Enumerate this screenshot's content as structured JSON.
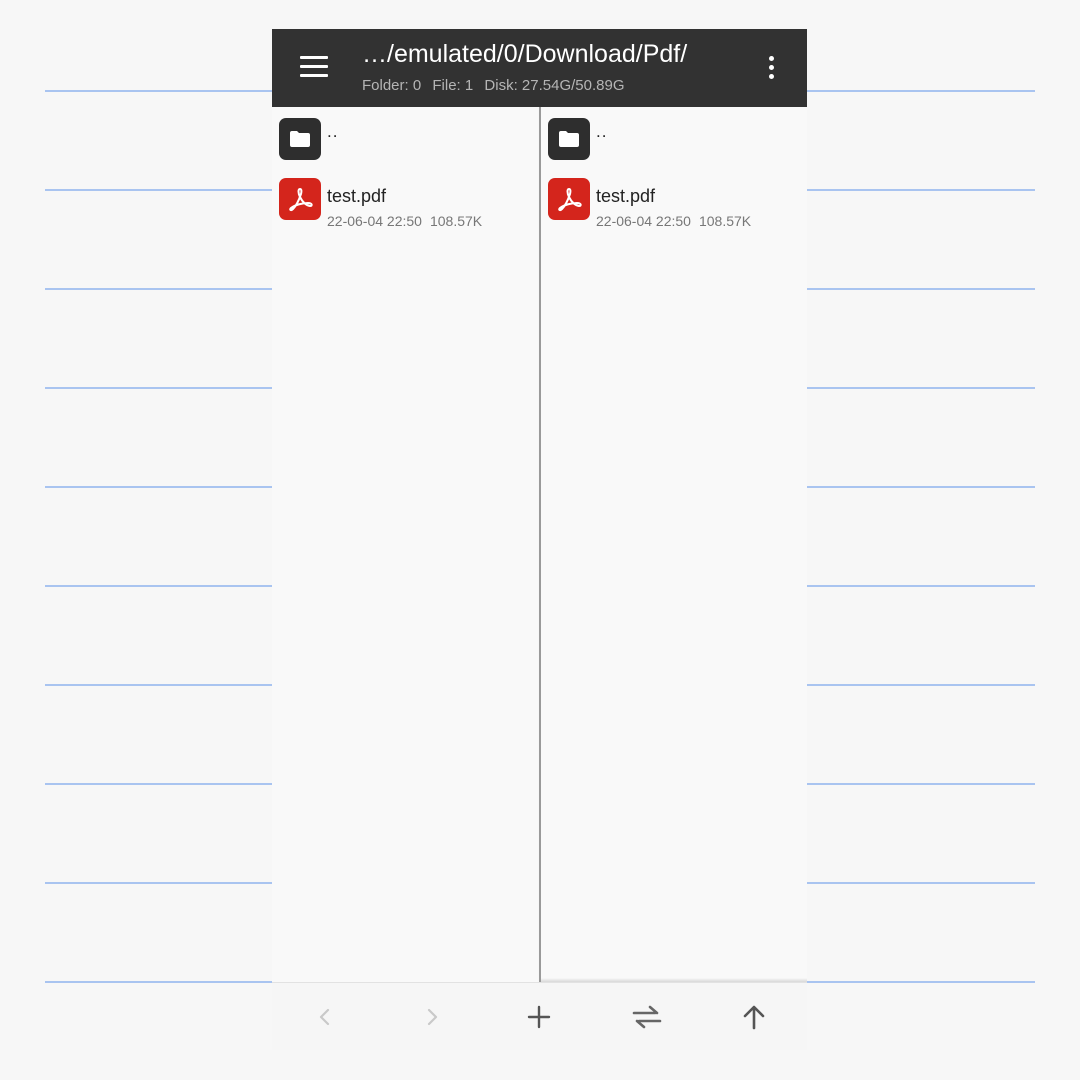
{
  "toolbar": {
    "path": "…/emulated/0/Download/Pdf/",
    "folder_count": "Folder: 0",
    "file_count": "File: 1",
    "disk": "Disk: 27.54G/50.89G",
    "menu_icon": "hamburger-menu-icon",
    "more_icon": "more-vertical-icon"
  },
  "panels": {
    "left": {
      "parent": "..",
      "file": {
        "name": "test.pdf",
        "date": "22-06-04 22:50",
        "size": "108.57K"
      }
    },
    "right": {
      "parent": "..",
      "file": {
        "name": "test.pdf",
        "date": "22-06-04 22:50",
        "size": "108.57K"
      }
    }
  },
  "bottombar": {
    "icons": [
      "back-arrow-icon",
      "forward-arrow-icon",
      "add-icon",
      "swap-panels-icon",
      "up-arrow-icon"
    ]
  },
  "colors": {
    "toolbar_bg": "#323232",
    "folder_icon_bg": "#2e2e2e",
    "pdf_icon_bg": "#d4251c",
    "background_lines": "#a9c4f0"
  }
}
